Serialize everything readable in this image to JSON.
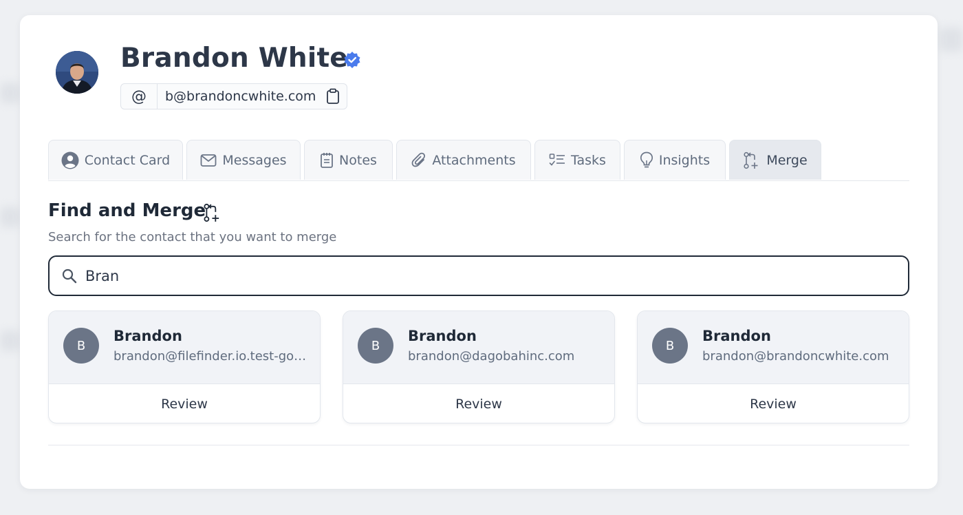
{
  "profile": {
    "name": "Brandon White",
    "email": "b@brandoncwhite.com",
    "verified": true,
    "at_symbol": "@"
  },
  "tabs": [
    {
      "label": "Contact Card",
      "icon": "user-circle-icon",
      "active": false
    },
    {
      "label": "Messages",
      "icon": "envelope-icon",
      "active": false
    },
    {
      "label": "Notes",
      "icon": "notepad-icon",
      "active": false
    },
    {
      "label": "Attachments",
      "icon": "paperclip-icon",
      "active": false
    },
    {
      "label": "Tasks",
      "icon": "checklist-icon",
      "active": false
    },
    {
      "label": "Insights",
      "icon": "lightbulb-icon",
      "active": false
    },
    {
      "label": "Merge",
      "icon": "git-merge-icon",
      "active": true
    }
  ],
  "merge": {
    "title": "Find and Merge",
    "subtitle": "Search for the contact that you want to merge",
    "search_value": "Bran",
    "results": [
      {
        "initial": "B",
        "name": "Brandon",
        "email": "brandon@filefinder.io.test-google-a.com",
        "action": "Review"
      },
      {
        "initial": "B",
        "name": "Brandon",
        "email": "brandon@dagobahinc.com",
        "action": "Review"
      },
      {
        "initial": "B",
        "name": "Brandon",
        "email": "brandon@brandoncwhite.com",
        "action": "Review"
      }
    ]
  },
  "colors": {
    "verified_badge": "#4a7bec",
    "search_border": "#1f2937",
    "active_tab_bg": "#e6e9ee",
    "result_avatar_bg": "#6b7587"
  }
}
